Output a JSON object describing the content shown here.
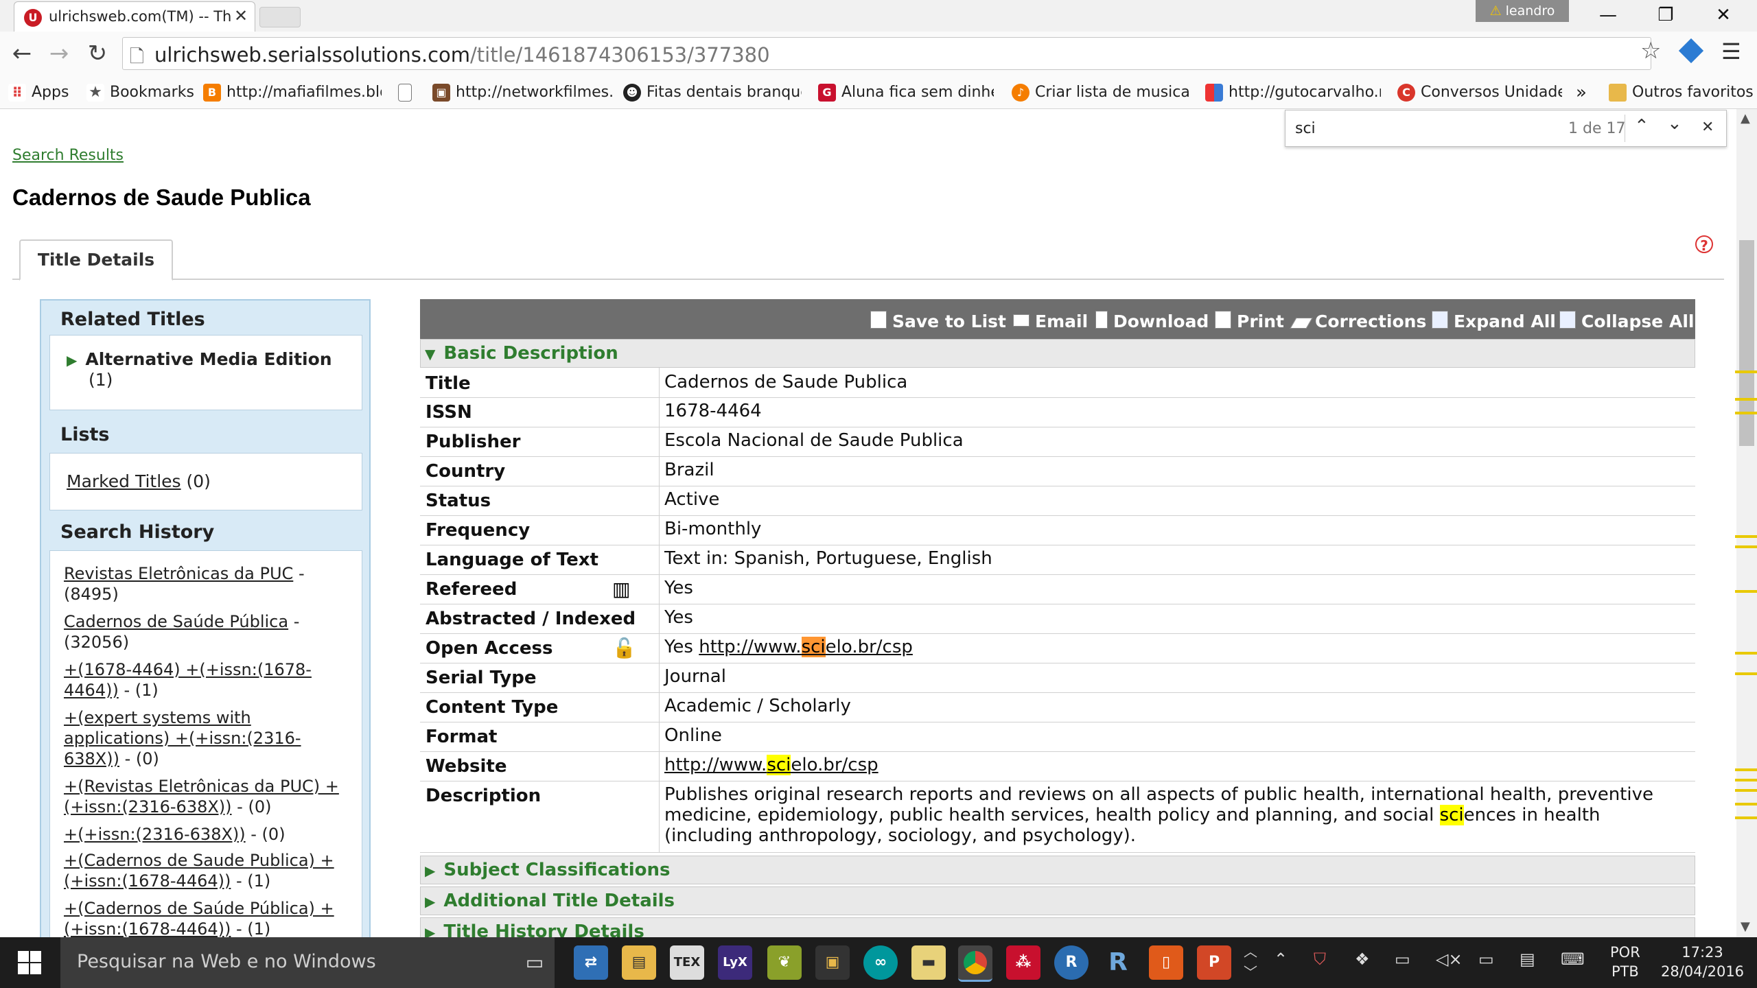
{
  "browser": {
    "tab_title": "ulrichsweb.com(TM) -- Th",
    "tab_close": "✕",
    "user_name": "leandro",
    "url_domain": "ulrichsweb.serialssolutions.com",
    "url_path": "/title/1461874306153/377380"
  },
  "bookmarks": [
    {
      "label": "Apps",
      "color": "#e04040"
    },
    {
      "label": "Bookmarks",
      "color": "#555555"
    },
    {
      "label": "http://mafiafilmes.blo",
      "color": "#f57d00"
    },
    {
      "label": "",
      "color": "#ffffff"
    },
    {
      "label": "http://networkfilmes.l",
      "color": "#7a4a2a"
    },
    {
      "label": "Fitas dentais branque",
      "color": "#222222"
    },
    {
      "label": "Aluna fica sem dinhei",
      "color": "#c8102e"
    },
    {
      "label": "Criar lista de musica c",
      "color": "#f57d00"
    },
    {
      "label": "http://gutocarvalho.n",
      "color": "#3a7bd5"
    },
    {
      "label": "Conversos Unidade",
      "color": "#d9362b"
    },
    {
      "label": "»",
      "color": "#ffffff"
    },
    {
      "label": "Outros favoritos",
      "color": "#e8b84a"
    }
  ],
  "find": {
    "query": "sci",
    "count": "1 de 17"
  },
  "page": {
    "breadcrumb": "Search Results",
    "title": "Cadernos de Saude Publica",
    "tab_label": "Title Details"
  },
  "sidebar": {
    "related_heading": "Related Titles",
    "related_item": "Alternative Media Edition",
    "related_count": "(1)",
    "lists_heading": "Lists",
    "marked_titles": "Marked Titles",
    "marked_count": "(0)",
    "history_heading": "Search History",
    "history": [
      {
        "link": "Revistas Eletrônicas da PUC",
        "count": " - (8495)"
      },
      {
        "link": "Cadernos de Saúde Pública",
        "count": " - (32056)"
      },
      {
        "link": "+(1678-4464) +(+issn:(1678-4464))",
        "count": " - (1)"
      },
      {
        "link": "+(expert systems with applications) +(+issn:(2316-638X))",
        "count": " - (0)"
      },
      {
        "link": "+(Revistas Eletrônicas da PUC) +(+issn:(2316-638X))",
        "count": " - (0)"
      },
      {
        "link": "+(+issn:(2316-638X))",
        "count": " - (0)"
      },
      {
        "link": "+(Cadernos de Saude Publica) +(+issn:(1678-4464))",
        "count": " - (1)"
      },
      {
        "link": "+(Cadernos de Saúde Pública) +(+issn:(1678-4464))",
        "count": " - (1)"
      }
    ]
  },
  "toolbar": {
    "save": "Save to List",
    "email": "Email",
    "download": "Download",
    "print": "Print",
    "corrections": "Corrections",
    "expand": "Expand All",
    "collapse": "Collapse All"
  },
  "sections": {
    "basic": "Basic Description",
    "subject": "Subject Classifications",
    "additional": "Additional Title Details",
    "history": "Title History Details"
  },
  "details": {
    "title": {
      "label": "Title",
      "value": "Cadernos de Saude Publica"
    },
    "issn": {
      "label": "ISSN",
      "value": "1678-4464"
    },
    "publisher": {
      "label": "Publisher",
      "value": "Escola Nacional de Saude Publica"
    },
    "country": {
      "label": "Country",
      "value": "Brazil"
    },
    "status": {
      "label": "Status",
      "value": "Active"
    },
    "frequency": {
      "label": "Frequency",
      "value": "Bi-monthly"
    },
    "language": {
      "label": "Language of Text",
      "value": "Text in: Spanish, Portuguese, English"
    },
    "refereed": {
      "label": "Refereed",
      "value": "Yes"
    },
    "abstracted": {
      "label": "Abstracted / Indexed",
      "value": "Yes"
    },
    "open_access": {
      "label": "Open Access",
      "value": "Yes",
      "link_pre": "http://www.",
      "link_hl": "sci",
      "link_post": "elo.br/csp"
    },
    "serial_type": {
      "label": "Serial Type",
      "value": "Journal"
    },
    "content_type": {
      "label": "Content Type",
      "value": "Academic / Scholarly"
    },
    "format": {
      "label": "Format",
      "value": "Online"
    },
    "website": {
      "label": "Website",
      "link_pre": "http://www.",
      "link_hl": "sci",
      "link_post": "elo.br/csp"
    },
    "description": {
      "label": "Description",
      "pre": "Publishes original research reports and reviews on all aspects of public health, international health, preventive medicine, epidemiology, public health services, health policy and planning, and social ",
      "hl": "sci",
      "post": "ences in health (including anthropology, sociology, and psychology)."
    }
  },
  "taskbar": {
    "search_placeholder": "Pesquisar na Web e no Windows",
    "lang_top": "POR",
    "lang_bottom": "PTB",
    "time": "17:23",
    "date": "28/04/2016"
  },
  "colors": {
    "link_green": "#2f7d2f",
    "highlight": "#ffff00",
    "current_highlight": "#ff9632",
    "toolbar_gray": "#6e6e6e",
    "sidebar_blue": "#d8eaf6"
  }
}
